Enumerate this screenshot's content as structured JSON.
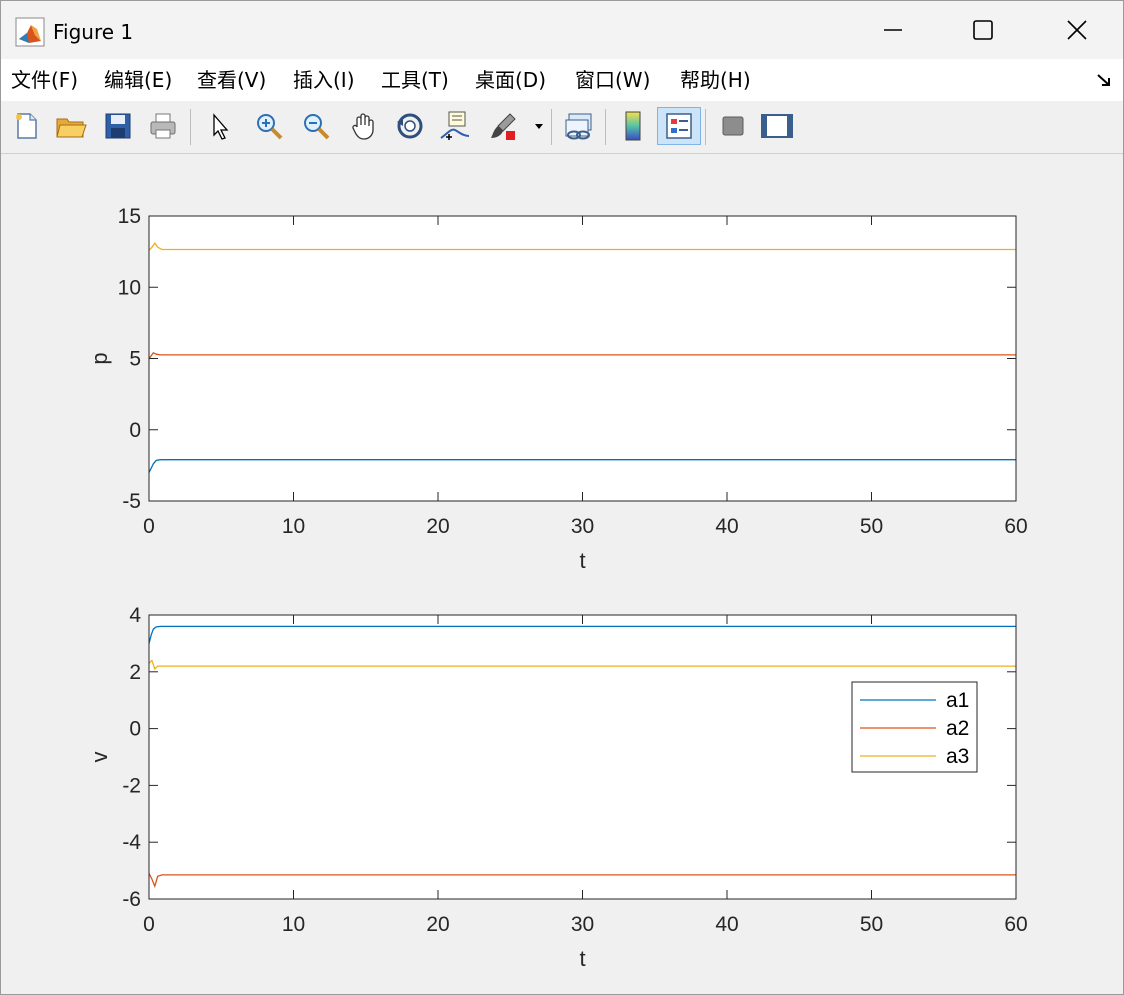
{
  "window": {
    "title": "Figure 1"
  },
  "menu": [
    "文件(F)",
    "编辑(E)",
    "查看(V)",
    "插入(I)",
    "工具(T)",
    "桌面(D)",
    "窗口(W)",
    "帮助(H)"
  ],
  "toolbar": {
    "icons": [
      "new-figure-icon",
      "open-file-icon",
      "save-icon",
      "print-icon",
      "select-pointer-icon",
      "zoom-in-icon",
      "zoom-out-icon",
      "pan-hand-icon",
      "rotate-3d-icon",
      "data-cursor-icon",
      "brush-icon",
      "link-plot-icon",
      "colorbar-icon",
      "legend-icon",
      "hide-plot-tools-icon",
      "show-plot-tools-icon"
    ]
  },
  "colors": {
    "a1": "#0072BD",
    "a2": "#D95319",
    "a3": "#EDB120"
  },
  "chart_data": [
    {
      "type": "line",
      "xlabel": "t",
      "ylabel": "p",
      "xlim": [
        0,
        60
      ],
      "ylim": [
        -5,
        15
      ],
      "xticks": [
        0,
        10,
        20,
        30,
        40,
        50,
        60
      ],
      "yticks": [
        -5,
        0,
        5,
        10,
        15
      ],
      "grid": false,
      "series": [
        {
          "name": "a1",
          "x": [
            0,
            0.15,
            0.3,
            0.5,
            0.8,
            60
          ],
          "y": [
            -3.0,
            -2.7,
            -2.4,
            -2.15,
            -2.1,
            -2.1
          ]
        },
        {
          "name": "a2",
          "x": [
            0,
            0.15,
            0.3,
            0.5,
            0.8,
            60
          ],
          "y": [
            5.0,
            5.2,
            5.4,
            5.3,
            5.25,
            5.25
          ]
        },
        {
          "name": "a3",
          "x": [
            0,
            0.2,
            0.4,
            0.6,
            0.9,
            60
          ],
          "y": [
            12.6,
            12.8,
            13.1,
            12.8,
            12.65,
            12.65
          ]
        }
      ]
    },
    {
      "type": "line",
      "xlabel": "t",
      "ylabel": "v",
      "xlim": [
        0,
        60
      ],
      "ylim": [
        -6,
        4
      ],
      "xticks": [
        0,
        10,
        20,
        30,
        40,
        50,
        60
      ],
      "yticks": [
        -6,
        -4,
        -2,
        0,
        2,
        4
      ],
      "grid": false,
      "legend": "inside-right",
      "series": [
        {
          "name": "a1",
          "x": [
            0,
            0.15,
            0.3,
            0.5,
            0.8,
            60
          ],
          "y": [
            3.0,
            3.3,
            3.5,
            3.58,
            3.6,
            3.6
          ]
        },
        {
          "name": "a2",
          "x": [
            0,
            0.2,
            0.4,
            0.6,
            0.9,
            60
          ],
          "y": [
            -5.1,
            -5.3,
            -5.55,
            -5.2,
            -5.15,
            -5.15
          ]
        },
        {
          "name": "a3",
          "x": [
            0,
            0.2,
            0.4,
            0.6,
            0.9,
            60
          ],
          "y": [
            2.3,
            2.4,
            2.1,
            2.2,
            2.2,
            2.2
          ]
        }
      ]
    }
  ]
}
